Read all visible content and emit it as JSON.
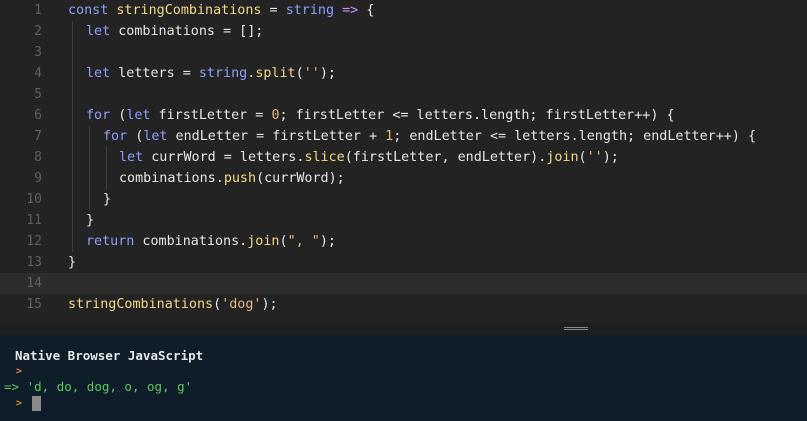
{
  "editor": {
    "lines": [
      {
        "n": "1",
        "current": false
      },
      {
        "n": "2",
        "current": false
      },
      {
        "n": "3",
        "current": false
      },
      {
        "n": "4",
        "current": false
      },
      {
        "n": "5",
        "current": false
      },
      {
        "n": "6",
        "current": false
      },
      {
        "n": "7",
        "current": false
      },
      {
        "n": "8",
        "current": false
      },
      {
        "n": "9",
        "current": false
      },
      {
        "n": "10",
        "current": false
      },
      {
        "n": "11",
        "current": false
      },
      {
        "n": "12",
        "current": false
      },
      {
        "n": "13",
        "current": false
      },
      {
        "n": "14",
        "current": true
      },
      {
        "n": "15",
        "current": false
      }
    ],
    "code": {
      "l1": {
        "kw": "const",
        "name": "stringCombinations",
        "eq": " = ",
        "param": "string",
        "arrow": " => ",
        "brace": "{"
      },
      "l2": {
        "kw": "let",
        "rest": " combinations = [];"
      },
      "l4": {
        "kw": "let",
        "mid": " letters = ",
        "obj": "string",
        "dot": ".",
        "fn": "split",
        "open": "(",
        "str": "''",
        "close": ");"
      },
      "l6": {
        "kw": "for",
        "a": " (",
        "kw2": "let",
        "b": " firstLetter = ",
        "num": "0",
        "c": "; firstLetter <= letters.length; firstLetter++) {"
      },
      "l7": {
        "kw": "for",
        "a": " (",
        "kw2": "let",
        "b": " endLetter = firstLetter + ",
        "num": "1",
        "c": "; endLetter <= letters.length; endLetter++) {"
      },
      "l8": {
        "kw": "let",
        "a": " currWord = letters.",
        "fn1": "slice",
        "b": "(firstLetter, endLetter).",
        "fn2": "join",
        "c": "(",
        "str": "''",
        "d": ");"
      },
      "l9": {
        "a": "combinations.",
        "fn": "push",
        "b": "(currWord);"
      },
      "l10": {
        "a": "}"
      },
      "l11": {
        "a": "}"
      },
      "l12": {
        "kw": "return",
        "a": " combinations.",
        "fn": "join",
        "b": "(",
        "str": "\", \"",
        "c": ");"
      },
      "l13": {
        "a": "}"
      },
      "l15": {
        "fn": "stringCombinations",
        "a": "(",
        "str": "'dog'",
        "b": ");"
      }
    }
  },
  "console": {
    "title": "Native Browser JavaScript",
    "prompt_glyph": ">",
    "result_arrow": "=>",
    "result": "'d, do, dog, o, og, g'"
  },
  "colors": {
    "editor_bg": "#232323",
    "console_bg": "#0f1c2a",
    "keyword": "#8f9dff",
    "string": "#e6b77d",
    "result_green": "#5cc95c",
    "prompt_orange": "#d28c3a"
  }
}
